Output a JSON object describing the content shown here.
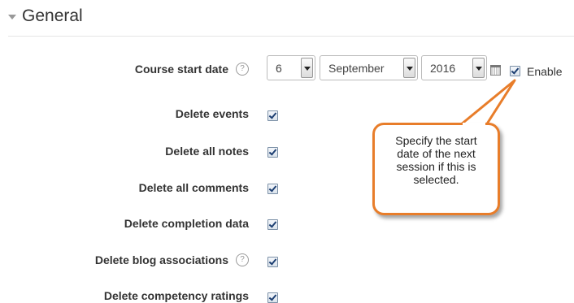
{
  "section": {
    "title": "General"
  },
  "course_start_date": {
    "label": "Course start date",
    "day": "6",
    "month": "September",
    "year": "2016",
    "enable_label": "Enable",
    "enable_checked": true
  },
  "options": [
    {
      "label": "Delete events",
      "checked": true,
      "has_help": false
    },
    {
      "label": "Delete all notes",
      "checked": true,
      "has_help": false
    },
    {
      "label": "Delete all comments",
      "checked": true,
      "has_help": false
    },
    {
      "label": "Delete completion data",
      "checked": true,
      "has_help": false
    },
    {
      "label": "Delete blog associations",
      "checked": true,
      "has_help": true
    },
    {
      "label": "Delete competency ratings",
      "checked": true,
      "has_help": false
    }
  ],
  "help_glyph": "?",
  "callout": {
    "lines": [
      "Specify the start",
      "date of the next",
      "session if this is",
      "selected."
    ]
  },
  "colors": {
    "callout_border": "#e87d2a",
    "checkbox_tick": "#1d3f72"
  }
}
